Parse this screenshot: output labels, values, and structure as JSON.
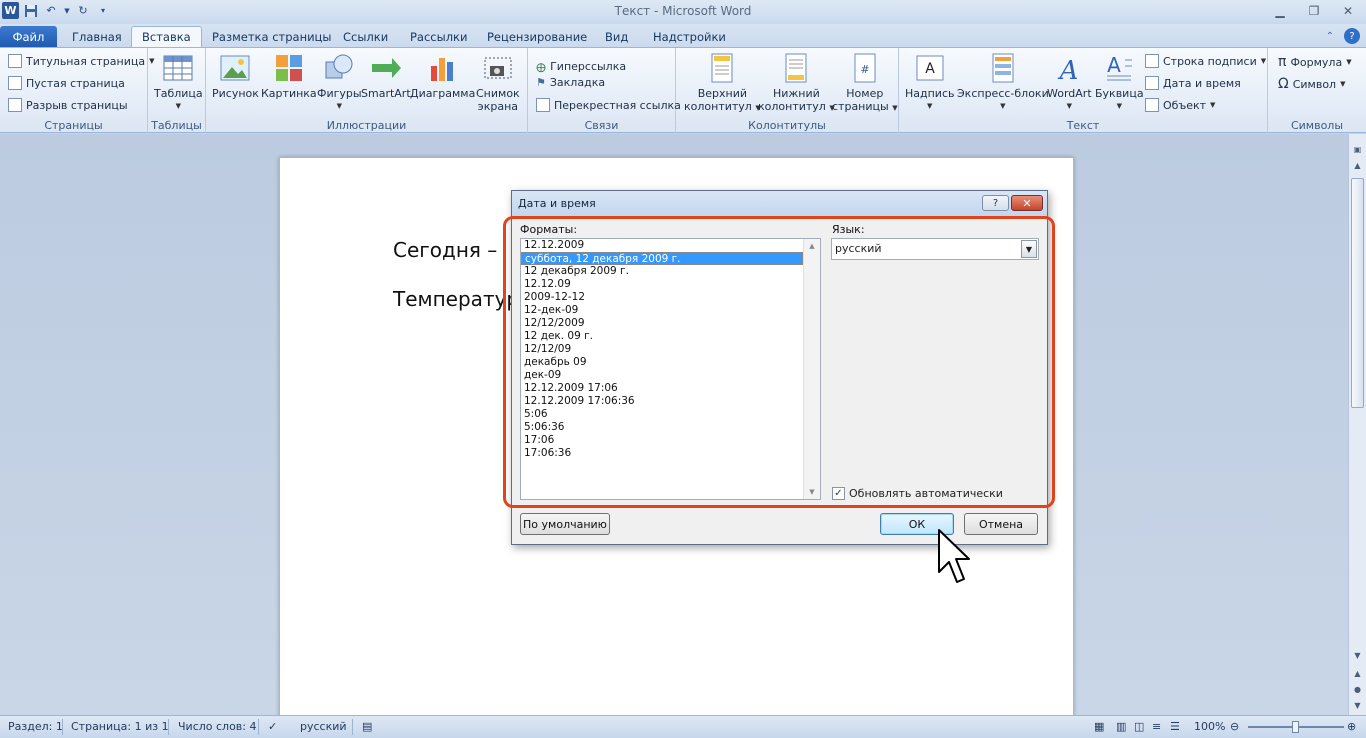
{
  "window": {
    "title": "Текст  -  Microsoft Word",
    "logo": "W",
    "qat_icons": [
      "save-icon",
      "undo-icon",
      "redo-icon",
      "customize-qat-icon"
    ],
    "controls": [
      "minimize-icon",
      "restore-icon",
      "close-icon"
    ]
  },
  "tabs": [
    {
      "label": "Файл"
    },
    {
      "label": "Главная"
    },
    {
      "label": "Вставка"
    },
    {
      "label": "Разметка страницы"
    },
    {
      "label": "Ссылки"
    },
    {
      "label": "Рассылки"
    },
    {
      "label": "Рецензирование"
    },
    {
      "label": "Вид"
    },
    {
      "label": "Надстройки"
    }
  ],
  "ribbon": {
    "pages": {
      "label": "Страницы",
      "items": [
        "Титульная страница",
        "Пустая страница",
        "Разрыв страницы"
      ]
    },
    "tables": {
      "label": "Таблицы",
      "table": "Таблица"
    },
    "illustrations": {
      "label": "Иллюстрации",
      "picture": "Рисунок",
      "clipart": "Картинка",
      "shapes": "Фигуры",
      "smartart": "SmartArt",
      "chart": "Диаграмма",
      "screenshot_l1": "Снимок",
      "screenshot_l2": "экрана"
    },
    "links": {
      "label": "Связи",
      "hyperlink": "Гиперссылка",
      "bookmark": "Закладка",
      "crossref": "Перекрестная ссылка"
    },
    "headerfooter": {
      "label": "Колонтитулы",
      "header_l1": "Верхний",
      "header_l2": "колонтитул",
      "footer_l1": "Нижний",
      "footer_l2": "колонтитул",
      "pagenum_l1": "Номер",
      "pagenum_l2": "страницы"
    },
    "text": {
      "label": "Текст",
      "textbox": "Надпись",
      "quickparts": "Экспресс-блоки",
      "wordart": "WordArt",
      "dropcap": "Буквица",
      "signature": "Строка подписи",
      "datetime": "Дата и время",
      "object": "Объект"
    },
    "symbols": {
      "label": "Символы",
      "equation": "Формула",
      "symbol": "Символ"
    }
  },
  "document": {
    "line1": "Сегодня –",
    "line2": "Температур"
  },
  "dialog": {
    "title": "Дата и время",
    "help_glyph": "?",
    "formats_label": "Форматы:",
    "formats": [
      "12.12.2009",
      "суббота, 12 декабря 2009 г.",
      "12 декабря 2009 г.",
      "12.12.09",
      "2009-12-12",
      "12-дек-09",
      "12/12/2009",
      "12 дек. 09 г.",
      "12/12/09",
      "декабрь 09",
      "дек-09",
      "12.12.2009 17:06",
      "12.12.2009 17:06:36",
      "5:06",
      "5:06:36",
      "17:06",
      "17:06:36"
    ],
    "selected_index": 1,
    "language_label": "Язык:",
    "language_value": "русский",
    "auto_update_label": "Обновлять автоматически",
    "auto_update_checked": true,
    "default_button": "По умолчанию",
    "ok_button": "ОК",
    "cancel_button": "Отмена"
  },
  "statusbar": {
    "section": "Раздел: 1",
    "page": "Страница: 1 из 1",
    "words": "Число слов: 4",
    "language": "русский",
    "zoom": "100%"
  },
  "colors": {
    "highlight_frame": "#e2431c",
    "selection": "#3399ff",
    "file_tab": "#2b5fb3"
  }
}
